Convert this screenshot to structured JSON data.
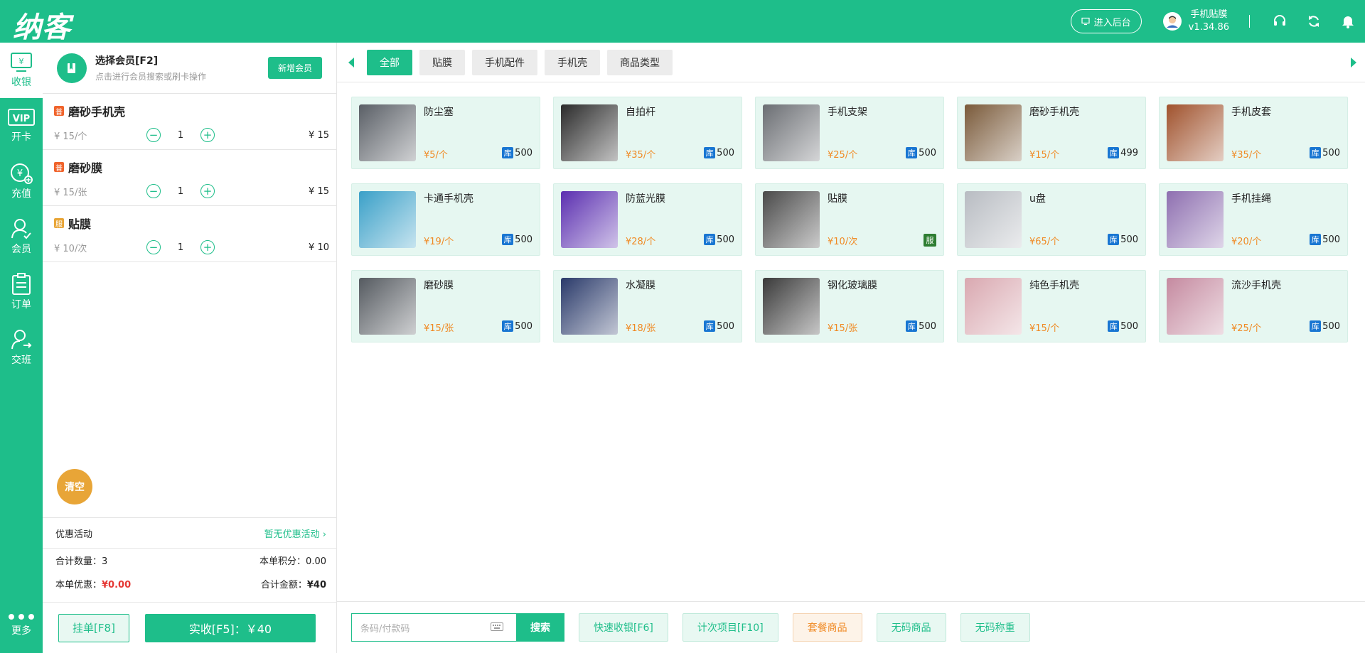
{
  "app": {
    "logo": "纳客"
  },
  "topbar": {
    "backend_label": "进入后台",
    "user_name": "手机贴膜",
    "version": "v1.34.86"
  },
  "sidenav": [
    {
      "label": "收银",
      "icon": "cashier-icon"
    },
    {
      "label": "开卡",
      "icon": "vip-card-icon"
    },
    {
      "label": "充值",
      "icon": "recharge-icon"
    },
    {
      "label": "会员",
      "icon": "member-icon"
    },
    {
      "label": "订单",
      "icon": "order-icon"
    },
    {
      "label": "交班",
      "icon": "shift-icon"
    }
  ],
  "sidenav_more": "更多",
  "member": {
    "title": "选择会员[F2]",
    "subtitle": "点击进行会员搜索或刷卡操作",
    "new_button": "新增会员"
  },
  "cart": [
    {
      "tag": "普",
      "tag_color": "#f0642c",
      "name": "磨砂手机壳",
      "unit_price": "¥ 15/个",
      "qty": "1",
      "subtotal": "¥ 15"
    },
    {
      "tag": "普",
      "tag_color": "#f0642c",
      "name": "磨砂膜",
      "unit_price": "¥ 15/张",
      "qty": "1",
      "subtotal": "¥ 15"
    },
    {
      "tag": "服",
      "tag_color": "#e8a537",
      "name": "贴膜",
      "unit_price": "¥ 10/次",
      "qty": "1",
      "subtotal": "¥ 10"
    }
  ],
  "clear_label": "清空",
  "promo": {
    "label": "优惠活动",
    "value": "暂无优惠活动"
  },
  "summary": {
    "qty_label": "合计数量：",
    "qty_value": "3",
    "points_label": "本单积分：",
    "points_value": "0.00",
    "discount_label": "本单优惠：",
    "discount_value": "¥0.00",
    "total_label": "合计金额：",
    "total_value": "¥40"
  },
  "hold_label": "挂单[F8]",
  "pay_label": "实收[F5]：￥40",
  "tabs": [
    "全部",
    "贴膜",
    "手机配件",
    "手机壳",
    "商品类型"
  ],
  "products": [
    {
      "name": "防尘塞",
      "price": "¥5/个",
      "stock": "500",
      "badge": "库",
      "color": "#5a5f66"
    },
    {
      "name": "自拍杆",
      "price": "¥35/个",
      "stock": "500",
      "badge": "库",
      "color": "#2b2b2b"
    },
    {
      "name": "手机支架",
      "price": "¥25/个",
      "stock": "500",
      "badge": "库",
      "color": "#6b6e73"
    },
    {
      "name": "磨砂手机壳",
      "price": "¥15/个",
      "stock": "499",
      "badge": "库",
      "color": "#7a5a3a"
    },
    {
      "name": "手机皮套",
      "price": "¥35/个",
      "stock": "500",
      "badge": "库",
      "color": "#a0522d"
    },
    {
      "name": "卡通手机壳",
      "price": "¥19/个",
      "stock": "500",
      "badge": "库",
      "color": "#3aa0c8"
    },
    {
      "name": "防蓝光膜",
      "price": "¥28/个",
      "stock": "500",
      "badge": "库",
      "color": "#5b2fb0"
    },
    {
      "name": "贴膜",
      "price": "¥10/次",
      "stock": "",
      "badge": "服",
      "color": "#4a4a4a"
    },
    {
      "name": "u盘",
      "price": "¥65/个",
      "stock": "500",
      "badge": "库",
      "color": "#b8bcc2"
    },
    {
      "name": "手机挂绳",
      "price": "¥20/个",
      "stock": "500",
      "badge": "库",
      "color": "#8e6fb0"
    },
    {
      "name": "磨砂膜",
      "price": "¥15/张",
      "stock": "500",
      "badge": "库",
      "color": "#555a60"
    },
    {
      "name": "水凝膜",
      "price": "¥18/张",
      "stock": "500",
      "badge": "库",
      "color": "#2a3a6a"
    },
    {
      "name": "钢化玻璃膜",
      "price": "¥15/张",
      "stock": "500",
      "badge": "库",
      "color": "#3a3a3a"
    },
    {
      "name": "纯色手机壳",
      "price": "¥15/个",
      "stock": "500",
      "badge": "库",
      "color": "#d9a8b0"
    },
    {
      "name": "流沙手机壳",
      "price": "¥25/个",
      "stock": "500",
      "badge": "库",
      "color": "#c58aa0"
    }
  ],
  "bottom": {
    "search_placeholder": "条码/付款码",
    "search_button": "搜索",
    "quick_cash": "快速收银[F6]",
    "count_item": "计次项目[F10]",
    "package": "套餐商品",
    "no_code": "无码商品",
    "no_code_weigh": "无码称重"
  },
  "colors": {
    "accent": "#1ebe8a",
    "price": "#f08a24",
    "stock_badge": "#1976d2"
  }
}
